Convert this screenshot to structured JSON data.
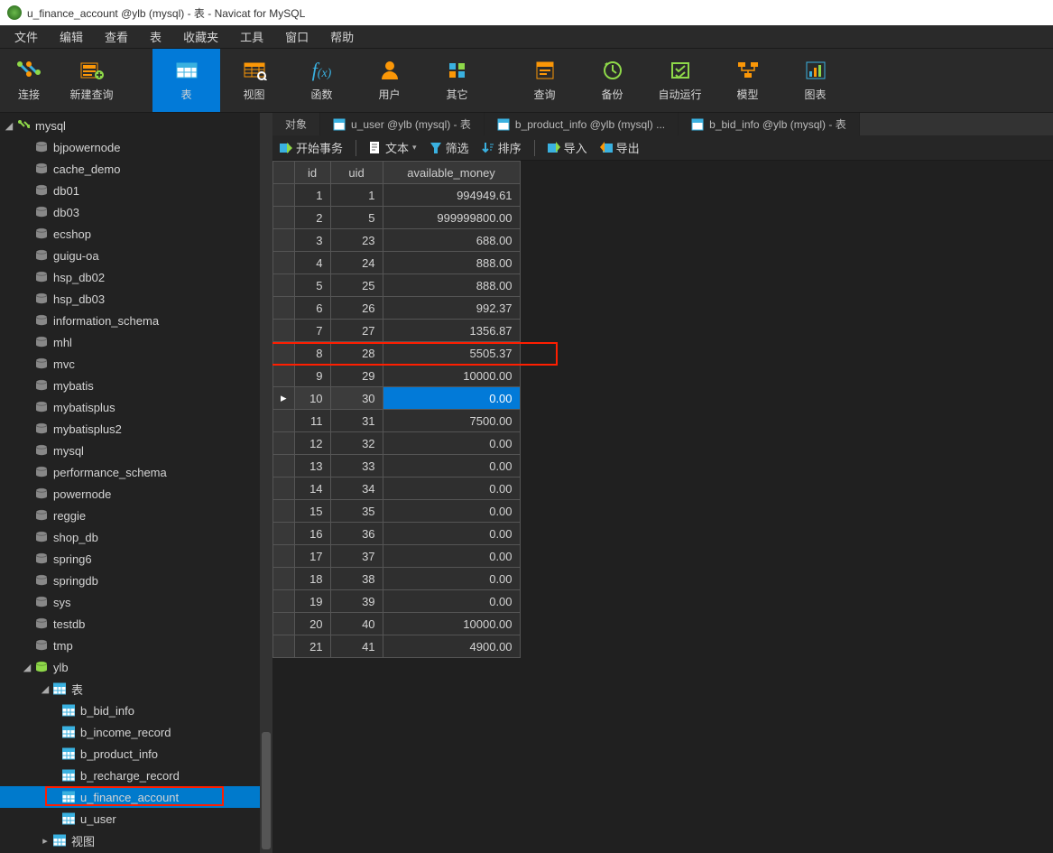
{
  "titlebar": "u_finance_account @ylb (mysql) - 表 - Navicat for MySQL",
  "menu": {
    "file": "文件",
    "edit": "编辑",
    "view": "查看",
    "table": "表",
    "fav": "收藏夹",
    "tool": "工具",
    "window": "窗口",
    "help": "帮助"
  },
  "tools": {
    "connect": "连接",
    "newquery": "新建查询",
    "table": "表",
    "view": "视图",
    "func": "函数",
    "user": "用户",
    "other": "其它",
    "query": "查询",
    "backup": "备份",
    "autorun": "自动运行",
    "model": "模型",
    "chart": "图表"
  },
  "tree": {
    "root": "mysql",
    "dbs": [
      "bjpowernode",
      "cache_demo",
      "db01",
      "db03",
      "ecshop",
      "guigu-oa",
      "hsp_db02",
      "hsp_db03",
      "information_schema",
      "mhl",
      "mvc",
      "mybatis",
      "mybatisplus",
      "mybatisplus2",
      "mysql",
      "performance_schema",
      "powernode",
      "reggie",
      "shop_db",
      "spring6",
      "springdb",
      "sys",
      "testdb",
      "tmp"
    ],
    "ylb": "ylb",
    "tables_label": "表",
    "tables": [
      "b_bid_info",
      "b_income_record",
      "b_product_info",
      "b_recharge_record",
      "u_finance_account",
      "u_user"
    ],
    "views_label": "视图"
  },
  "selected_table": "u_finance_account",
  "tabs": {
    "obj": "对象",
    "t1": "u_user @ylb (mysql) - 表",
    "t2": "b_product_info @ylb (mysql) ...",
    "t3": "b_bid_info @ylb (mysql) - 表"
  },
  "subbar": {
    "begintx": "开始事务",
    "text": "文本",
    "filter": "筛选",
    "sort": "排序",
    "import": "导入",
    "export": "导出"
  },
  "columns": {
    "id": "id",
    "uid": "uid",
    "money": "available_money"
  },
  "rows": [
    {
      "id": "1",
      "uid": "1",
      "money": "994949.61"
    },
    {
      "id": "2",
      "uid": "5",
      "money": "999999800.00"
    },
    {
      "id": "3",
      "uid": "23",
      "money": "688.00"
    },
    {
      "id": "4",
      "uid": "24",
      "money": "888.00"
    },
    {
      "id": "5",
      "uid": "25",
      "money": "888.00"
    },
    {
      "id": "6",
      "uid": "26",
      "money": "992.37"
    },
    {
      "id": "7",
      "uid": "27",
      "money": "1356.87"
    },
    {
      "id": "8",
      "uid": "28",
      "money": "5505.37"
    },
    {
      "id": "9",
      "uid": "29",
      "money": "10000.00"
    },
    {
      "id": "10",
      "uid": "30",
      "money": "0.00"
    },
    {
      "id": "11",
      "uid": "31",
      "money": "7500.00"
    },
    {
      "id": "12",
      "uid": "32",
      "money": "0.00"
    },
    {
      "id": "13",
      "uid": "33",
      "money": "0.00"
    },
    {
      "id": "14",
      "uid": "34",
      "money": "0.00"
    },
    {
      "id": "15",
      "uid": "35",
      "money": "0.00"
    },
    {
      "id": "16",
      "uid": "36",
      "money": "0.00"
    },
    {
      "id": "17",
      "uid": "37",
      "money": "0.00"
    },
    {
      "id": "18",
      "uid": "38",
      "money": "0.00"
    },
    {
      "id": "19",
      "uid": "39",
      "money": "0.00"
    },
    {
      "id": "20",
      "uid": "40",
      "money": "10000.00"
    },
    {
      "id": "21",
      "uid": "41",
      "money": "4900.00"
    }
  ],
  "selected_row_idx": 9,
  "highlight_row_idx": 7
}
